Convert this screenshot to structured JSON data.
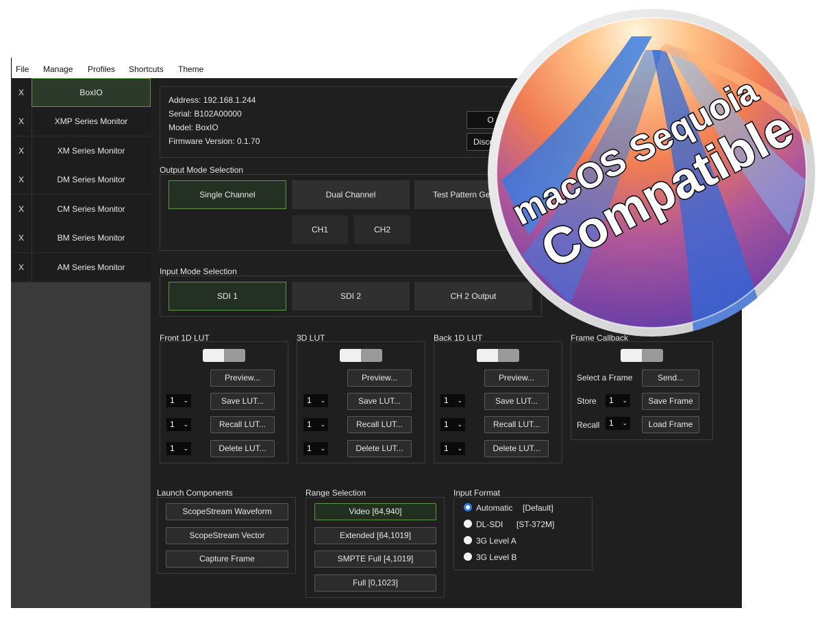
{
  "menu": [
    "File",
    "Manage",
    "Profiles",
    "Shortcuts",
    "Theme"
  ],
  "sidebar": {
    "remove_label": "X",
    "devices": [
      "BoxIO",
      "XMP Series Monitor",
      "XM Series Monitor",
      "DM Series Monitor",
      "CM Series Monitor",
      "BM Series Monitor",
      "AM Series Monitor"
    ],
    "selected": "BoxIO"
  },
  "device_info": {
    "address": "Address: 192.168.1.244",
    "serial": "Serial: B102A00000",
    "model": "Model: BoxIO",
    "firmware": "Firmware Version: 0.1.70",
    "btn1_label": "O",
    "btn2_label": "Disco"
  },
  "output_mode": {
    "title": "Output Mode Selection",
    "options": [
      "Single Channel",
      "Dual Channel",
      "Test Pattern Gen"
    ],
    "selected": "Single Channel",
    "channels": [
      "CH1",
      "CH2"
    ]
  },
  "input_mode": {
    "title": "Input Mode Selection",
    "options": [
      "SDI 1",
      "SDI 2",
      "CH 2 Output"
    ],
    "selected": "SDI 1"
  },
  "luts": [
    {
      "title": "Front 1D LUT",
      "preview": "Preview...",
      "save": "Save LUT...",
      "recall": "Recall LUT...",
      "delete": "Delete LUT...",
      "slot_values": [
        "1",
        "1",
        "1"
      ]
    },
    {
      "title": "3D LUT",
      "preview": "Preview...",
      "save": "Save LUT...",
      "recall": "Recall LUT...",
      "delete": "Delete LUT...",
      "slot_values": [
        "1",
        "1",
        "1"
      ]
    },
    {
      "title": "Back 1D LUT",
      "preview": "Preview...",
      "save": "Save LUT...",
      "recall": "Recall LUT...",
      "delete": "Delete LUT...",
      "slot_values": [
        "1",
        "1",
        "1"
      ]
    }
  ],
  "frame_callback": {
    "title": "Frame Callback",
    "select_label": "Select a Frame",
    "send": "Send...",
    "store_label": "Store",
    "store_value": "1",
    "save_frame": "Save Frame",
    "recall_label": "Recall",
    "recall_value": "1",
    "load_frame": "Load Frame"
  },
  "launch": {
    "title": "Launch Components",
    "buttons": [
      "ScopeStream Waveform",
      "ScopeStream Vector",
      "Capture Frame"
    ]
  },
  "range": {
    "title": "Range Selection",
    "options": [
      "Video [64,940]",
      "Extended [64,1019]",
      "SMPTE Full [4,1019]",
      "Full [0,1023]"
    ],
    "selected": "Video [64,940]"
  },
  "input_format": {
    "title": "Input Format",
    "options": [
      {
        "label": "Automatic",
        "note": "[Default]"
      },
      {
        "label": "DL-SDI",
        "note": "[ST-372M]"
      },
      {
        "label": "3G Level A",
        "note": ""
      },
      {
        "label": "3G Level B",
        "note": ""
      }
    ],
    "selected": "Automatic"
  },
  "badge": {
    "line1": "macOS Sequoia",
    "line2": "Compatible"
  },
  "colors": {
    "accent_green": "#5f9a3f",
    "radio_blue": "#2b7cf0",
    "panel_bg": "#1f1f1f"
  }
}
